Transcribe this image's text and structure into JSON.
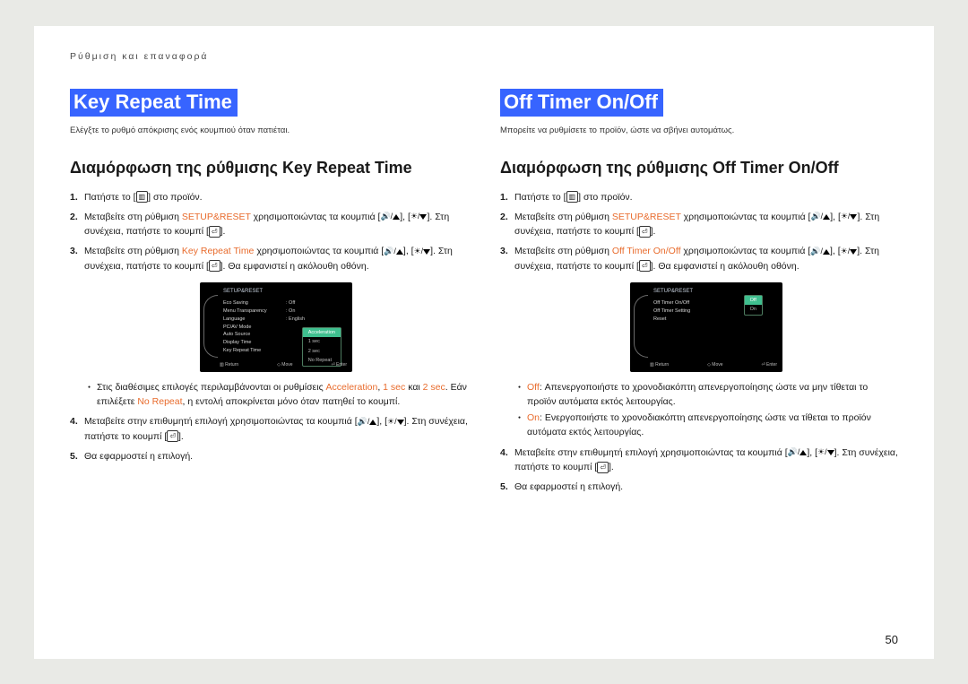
{
  "breadcrumb": "Ρύθμιση και επαναφορά",
  "page_number": "50",
  "icons": {
    "menu": "▥",
    "enter": "⏎",
    "vol_up": "🔊/▲",
    "bright_down": "☼/▼"
  },
  "left": {
    "title": "Key Repeat Time",
    "desc": "Ελέγξτε το ρυθμό απόκρισης ενός κουμπιού όταν πατιέται.",
    "subtitle": "Διαμόρφωση της ρύθμισης Key Repeat Time",
    "steps": {
      "s1_a": "Πατήστε το [",
      "s1_b": "] στο προϊόν.",
      "s2_a": "Μεταβείτε στη ρύθμιση ",
      "s2_link": "SETUP&RESET",
      "s2_b": " χρησιμοποιώντας τα κουμπιά [",
      "s2_c": "], [",
      "s2_d": "]. Στη συνέχεια, πατήστε το κουμπί [",
      "s2_e": "].",
      "s3_a": "Μεταβείτε στη ρύθμιση ",
      "s3_link": "Key Repeat Time",
      "s3_b": " χρησιμοποιώντας τα κουμπιά [",
      "s3_c": "], [",
      "s3_d": "]. Στη συνέχεια, πατήστε το κουμπί [",
      "s3_e": "]. Θα εμφανιστεί η ακόλουθη οθόνη.",
      "bullet_a": "Στις διαθέσιμες επιλογές περιλαμβάνονται οι ρυθμίσεις ",
      "bullet_l1": "Acceleration",
      "bullet_m1": ", ",
      "bullet_l2": "1 sec",
      "bullet_m2": " και ",
      "bullet_l3": "2 sec",
      "bullet_m3": ". Εάν επιλέξετε ",
      "bullet_l4": "No Repeat",
      "bullet_b": ", η εντολή αποκρίνεται μόνο όταν πατηθεί το κουμπί.",
      "s4_a": "Μεταβείτε στην επιθυμητή επιλογή χρησιμοποιώντας τα κουμπιά [",
      "s4_b": "], [",
      "s4_c": "]. Στη συνέχεια, πατήστε το κουμπί [",
      "s4_d": "].",
      "s5": "Θα εφαρμοστεί η επιλογή."
    },
    "ss": {
      "header": "SETUP&RESET",
      "rows": [
        {
          "l": "Eco Saving",
          "r": ": Off"
        },
        {
          "l": "Menu Transparency",
          "r": ": On"
        },
        {
          "l": "Language",
          "r": ": English"
        },
        {
          "l": "PC/AV Mode",
          "r": ""
        },
        {
          "l": "Auto Source",
          "r": ""
        },
        {
          "l": "Display Time",
          "r": ""
        },
        {
          "l": "Key Repeat Time",
          "r": ""
        }
      ],
      "dropdown": [
        "Acceleration",
        "1 sec",
        "2 sec",
        "No Repeat"
      ],
      "footer": {
        "l": "▥ Return",
        "m": "◇ Move",
        "r": "⏎ Enter"
      }
    }
  },
  "right": {
    "title": "Off Timer On/Off",
    "desc": "Μπορείτε να ρυθμίσετε το προϊόν, ώστε να σβήνει αυτομάτως.",
    "subtitle": "Διαμόρφωση της ρύθμισης Off Timer On/Off",
    "steps": {
      "s1_a": "Πατήστε το [",
      "s1_b": "] στο προϊόν.",
      "s2_a": "Μεταβείτε στη ρύθμιση ",
      "s2_link": "SETUP&RESET",
      "s2_b": " χρησιμοποιώντας τα κουμπιά [",
      "s2_c": "], [",
      "s2_d": "]. Στη συνέχεια, πατήστε το κουμπί [",
      "s2_e": "].",
      "s3_a": "Μεταβείτε στη ρύθμιση ",
      "s3_link": "Off Timer On/Off",
      "s3_b": " χρησιμοποιώντας τα κουμπιά [",
      "s3_c": "], [",
      "s3_d": "]. Στη συνέχεια, πατήστε το κουμπί [",
      "s3_e": "]. Θα εμφανιστεί η ακόλουθη οθόνη.",
      "b1_l": "Off",
      "b1_t": ": Απενεργοποιήστε το χρονοδιακόπτη απενεργοποίησης ώστε να μην τίθεται το προϊόν αυτόματα εκτός λειτουργίας.",
      "b2_l": "On",
      "b2_t": ": Ενεργοποιήστε το χρονοδιακόπτη απενεργοποίησης ώστε να τίθεται το προϊόν αυτόματα εκτός λειτουργίας.",
      "s4_a": "Μεταβείτε στην επιθυμητή επιλογή χρησιμοποιώντας τα κουμπιά [",
      "s4_b": "], [",
      "s4_c": "]. Στη συνέχεια, πατήστε το κουμπί [",
      "s4_d": "].",
      "s5": "Θα εφαρμοστεί η επιλογή."
    },
    "ss": {
      "header": "SETUP&RESET",
      "rows": [
        {
          "l": "Off Timer On/Off",
          "r": ""
        },
        {
          "l": "Off Timer Setting",
          "r": ""
        },
        {
          "l": "Reset",
          "r": ""
        }
      ],
      "dropdown": [
        "Off",
        "On"
      ],
      "footer": {
        "l": "▥ Return",
        "m": "◇ Move",
        "r": "⏎ Enter"
      }
    }
  }
}
